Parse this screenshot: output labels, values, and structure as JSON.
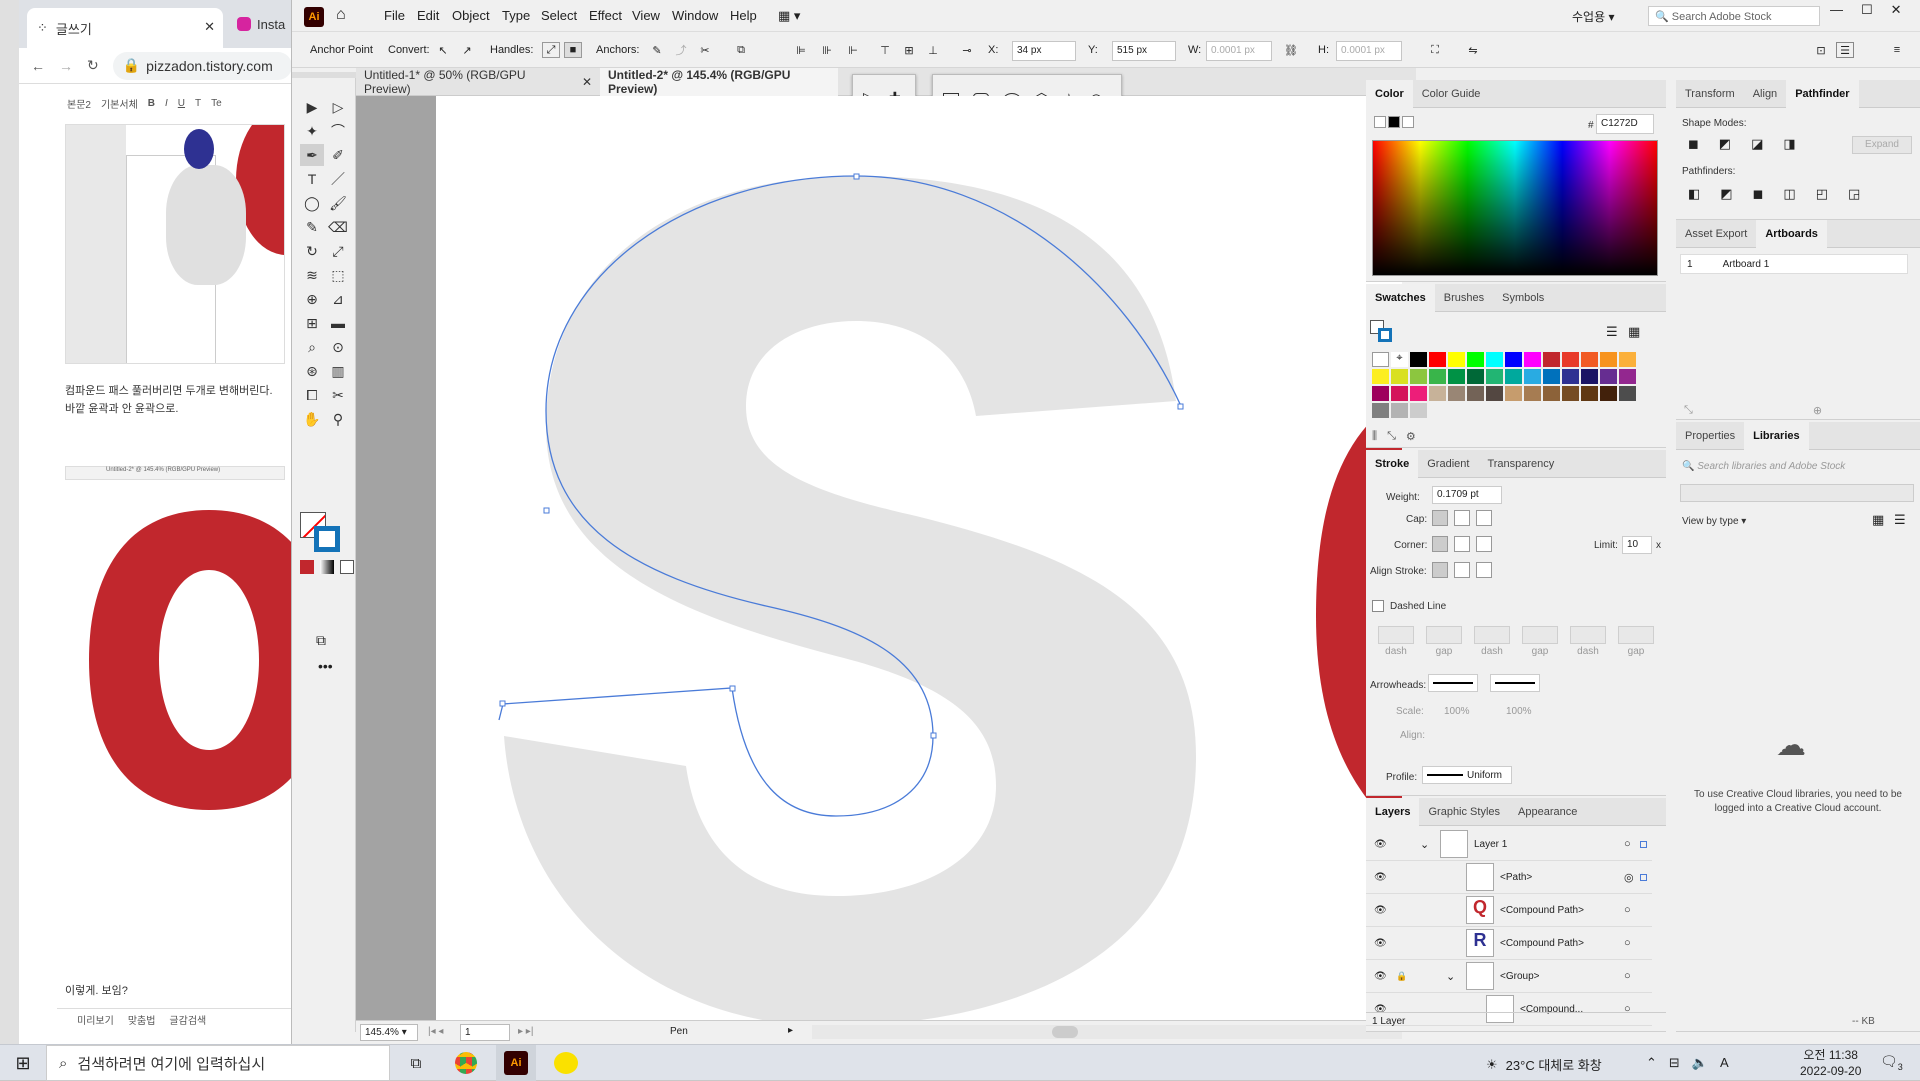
{
  "browser": {
    "tab1": "글쓰기",
    "tab2": "Insta",
    "url": "pizzadon.tistory.com",
    "toolbar": [
      "본문2",
      "기본서체",
      "B",
      "I",
      "U",
      "T",
      "Te"
    ],
    "text1": "컴파운드 패스 풀러버리면 두개로 변해버린다.",
    "text2": "바깥 윤곽과 안 윤곽으로.",
    "text3": "이렇게. 보임?",
    "bottom": [
      "미리보기",
      "맞춤법",
      "글감검색"
    ],
    "mini_tab1": "Untitled-2* @ 145.4% (RGB/GPU Preview)"
  },
  "ai": {
    "logo": "Ai",
    "menus": [
      "File",
      "Edit",
      "Object",
      "Type",
      "Select",
      "Effect",
      "View",
      "Window",
      "Help"
    ],
    "workspace": "수업용",
    "search_placeholder": "Search Adobe Stock",
    "ctrl": {
      "anchor_point": "Anchor Point",
      "convert": "Convert:",
      "handles": "Handles:",
      "anchors": "Anchors:",
      "x_label": "X:",
      "x": "34 px",
      "y_label": "Y:",
      "y": "515 px",
      "w_label": "W:",
      "w": "0.0001 px",
      "h_label": "H:",
      "h": "0.0001 px"
    },
    "doc_tabs": [
      "Untitled-1* @ 50% (RGB/GPU Preview)",
      "Untitled-2* @ 145.4% (RGB/GPU Preview)"
    ],
    "zoom": "145.4%",
    "page": "1",
    "tool_status": "Pen",
    "layers_count": "1 Layer",
    "kb": "-- KB"
  },
  "color_panel": {
    "tabs": [
      "Color",
      "Color Guide"
    ],
    "hex_label": "#",
    "hex": "C1272D"
  },
  "swatches_panel": {
    "tabs": [
      "Swatches",
      "Brushes",
      "Symbols"
    ],
    "colors": [
      "#000000",
      "#ff0000",
      "#ffff00",
      "#00ff00",
      "#00ffff",
      "#0000ff",
      "#ff00ff",
      "#c1272d",
      "#e83a2a",
      "#f15a24",
      "#f7931e",
      "#fbb03b",
      "#fcee21",
      "#d9e021",
      "#8cc63f",
      "#39b54a",
      "#009245",
      "#006837",
      "#22b573",
      "#00a99d",
      "#29abe2",
      "#0071bc",
      "#2e3192",
      "#1b1464",
      "#662d91",
      "#93278f",
      "#9e005d",
      "#d4145a",
      "#ed1e79",
      "#c7b299",
      "#998675",
      "#736357",
      "#534741",
      "#c69c6d",
      "#a67c52",
      "#8c6239",
      "#754c24",
      "#603813",
      "#42210b",
      "#4d4d4d",
      "#808080",
      "#b3b3b3",
      "#cccccc"
    ]
  },
  "stroke_panel": {
    "tabs": [
      "Stroke",
      "Gradient",
      "Transparency"
    ],
    "weight_label": "Weight:",
    "weight": "0.1709 pt",
    "cap_label": "Cap:",
    "corner_label": "Corner:",
    "limit_label": "Limit:",
    "limit": "10",
    "limit_unit": "x",
    "align_label": "Align Stroke:",
    "dashed": "Dashed Line",
    "dash_labels": [
      "dash",
      "gap",
      "dash",
      "gap",
      "dash",
      "gap"
    ],
    "arrowheads": "Arrowheads:",
    "scale": "Scale:",
    "scale1": "100%",
    "scale2": "100%",
    "align2": "Align:",
    "profile_label": "Profile:",
    "profile": "Uniform"
  },
  "layers_panel": {
    "tabs": [
      "Layers",
      "Graphic Styles",
      "Appearance"
    ],
    "rows": [
      "Layer 1",
      "<Path>",
      "<Compound Path>",
      "<Compound Path>",
      "<Group>",
      "<Compound..."
    ]
  },
  "pathfinder_panel": {
    "tabs": [
      "Transform",
      "Align",
      "Pathfinder"
    ],
    "shape_modes": "Shape Modes:",
    "pathfinders": "Pathfinders:",
    "expand": "Expand"
  },
  "artboards_panel": {
    "tabs": [
      "Asset Export",
      "Artboards"
    ],
    "num": "1",
    "name": "Artboard 1"
  },
  "libraries_panel": {
    "tabs": [
      "Properties",
      "Libraries"
    ],
    "search_placeholder": "Search libraries and Adobe Stock",
    "view": "View by type",
    "message": "To use Creative Cloud libraries, you need to be logged into a Creative Cloud account."
  },
  "taskbar": {
    "search": "검색하려면 여기에 입력하십시",
    "weather": "23°C 대체로 화창",
    "time": "오전 11:38",
    "date": "2022-09-20",
    "notif": "3",
    "ime": "A"
  }
}
